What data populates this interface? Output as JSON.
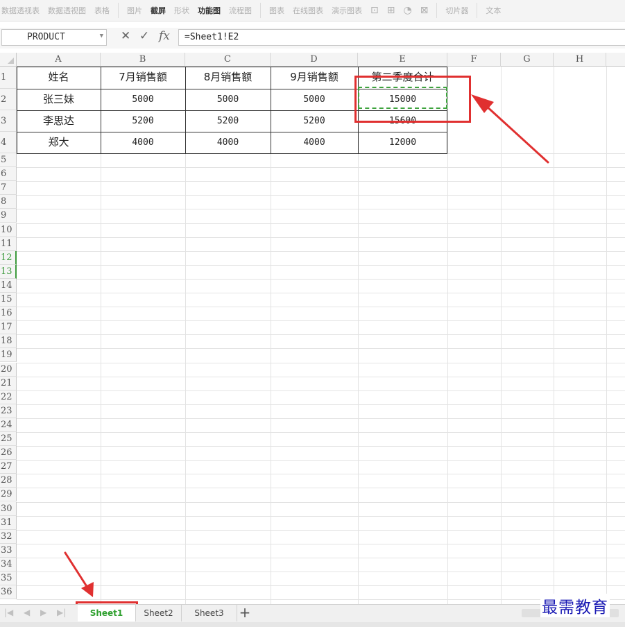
{
  "ribbon": {
    "items": [
      "数据透视表",
      "数据透视图",
      "表格",
      "图片",
      "截屏",
      "形状",
      "功能图",
      "流程图",
      "图表",
      "在线图表",
      "演示图表",
      "切片器",
      "文本"
    ]
  },
  "formula_bar": {
    "name_box": "PRODUCT",
    "cancel_icon": "✕",
    "confirm_icon": "✓",
    "fx_label": "fx",
    "formula": "=Sheet1!E2"
  },
  "columns": [
    "A",
    "B",
    "C",
    "D",
    "E",
    "F",
    "G",
    "H"
  ],
  "rows": [
    "1",
    "2",
    "3",
    "4",
    "5",
    "6",
    "7",
    "8",
    "9",
    "10",
    "11",
    "12",
    "13",
    "14",
    "15",
    "16",
    "17",
    "18",
    "19",
    "20",
    "21",
    "22",
    "23",
    "24",
    "25",
    "26",
    "27",
    "28",
    "29",
    "30",
    "31",
    "32",
    "33",
    "34",
    "35",
    "36"
  ],
  "selected_rows": [
    "12",
    "13"
  ],
  "table": {
    "headers": [
      "姓名",
      "7月销售额",
      "8月销售额",
      "9月销售额",
      "第二季度合计"
    ],
    "rows": [
      [
        "张三妹",
        "5000",
        "5000",
        "5000",
        "15000"
      ],
      [
        "李思达",
        "5200",
        "5200",
        "5200",
        "15600"
      ],
      [
        "郑大",
        "4000",
        "4000",
        "4000",
        "12000"
      ]
    ]
  },
  "sheet_tabs": {
    "tabs": [
      "Sheet1",
      "Sheet2",
      "Sheet3"
    ],
    "active": "Sheet1",
    "add_label": "+"
  },
  "watermark": "最需教育",
  "colors": {
    "accent_green": "#2ea02e",
    "annotation_red": "#e03030",
    "watermark_blue": "#1a1ab4"
  }
}
